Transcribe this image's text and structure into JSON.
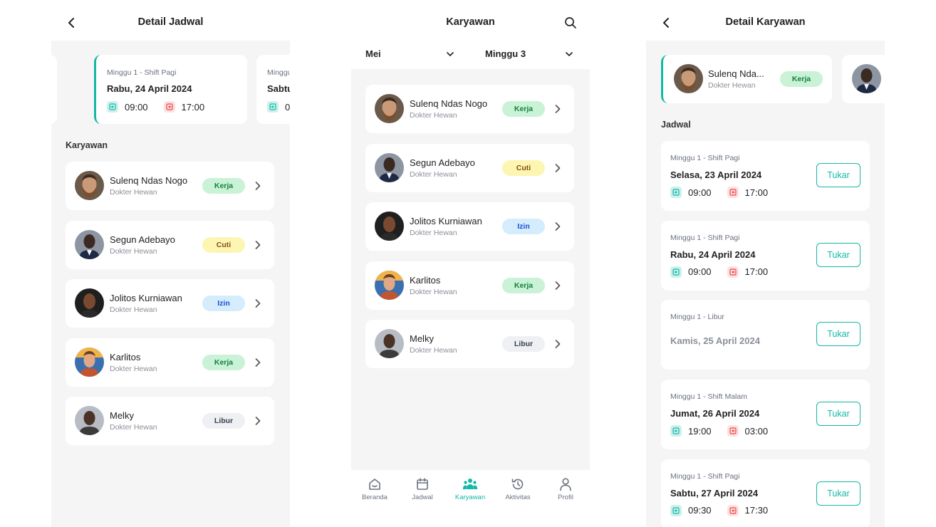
{
  "screen1": {
    "title": "Detail Jadwal",
    "schedule_cards": [
      {
        "sub": "Minggu 1 - Shift Pagi",
        "date": "Rabu, 24 April 2024",
        "in": "09:00",
        "out": "17:00"
      },
      {
        "sub": "Minggu",
        "date": "Sabtu",
        "in": "0"
      }
    ],
    "section_label": "Karyawan"
  },
  "screen2": {
    "title": "Karyawan",
    "month": "Mei",
    "week": "Minggu 3",
    "nav": [
      {
        "label": "Beranda",
        "icon": "home-icon"
      },
      {
        "label": "Jadwal",
        "icon": "calendar-icon"
      },
      {
        "label": "Karyawan",
        "icon": "people-icon"
      },
      {
        "label": "Aktivitas",
        "icon": "history-icon"
      },
      {
        "label": "Profil",
        "icon": "user-icon"
      }
    ],
    "active_nav": "Karyawan"
  },
  "employees": [
    {
      "name": "Sulenq Ndas Nogo",
      "role": "Dokter Hewan",
      "status": "Kerja"
    },
    {
      "name": "Segun Adebayo",
      "role": "Dokter Hewan",
      "status": "Cuti"
    },
    {
      "name": "Jolitos Kurniawan",
      "role": "Dokter Hewan",
      "status": "Izin"
    },
    {
      "name": "Karlitos",
      "role": "Dokter Hewan",
      "status": "Kerja"
    },
    {
      "name": "Melky",
      "role": "Dokter Hewan",
      "status": "Libur"
    }
  ],
  "screen3": {
    "title": "Detail Karyawan",
    "employee": {
      "name": "Sulenq Nda...",
      "role": "Dokter Hewan",
      "status": "Kerja"
    },
    "section_label": "Jadwal",
    "action_label": "Tukar",
    "schedules": [
      {
        "sub": "Minggu 1 - Shift Pagi",
        "date": "Selasa, 23 April 2024",
        "in": "09:00",
        "out": "17:00"
      },
      {
        "sub": "Minggu 1 - Shift Pagi",
        "date": "Rabu, 24 April 2024",
        "in": "09:00",
        "out": "17:00"
      },
      {
        "sub": "Minggu 1 - Libur",
        "date": "Kamis, 25 April 2024"
      },
      {
        "sub": "Minggu 1 - Shift Malam",
        "date": "Jumat, 26 April 2024",
        "in": "19:00",
        "out": "03:00"
      },
      {
        "sub": "Minggu 1 - Shift Pagi",
        "date": "Sabtu, 27 April 2024",
        "in": "09:30",
        "out": "17:30"
      }
    ]
  },
  "colors": {
    "accent": "#14b8a6",
    "kerja_bg": "#c9f2d6",
    "kerja_fg": "#15803d",
    "cuti_bg": "#fdf6b2",
    "cuti_fg": "#854d0e",
    "izin_bg": "#d4ecfb",
    "izin_fg": "#1d4ed8",
    "libur_bg": "#eef0f3",
    "libur_fg": "#374151"
  }
}
